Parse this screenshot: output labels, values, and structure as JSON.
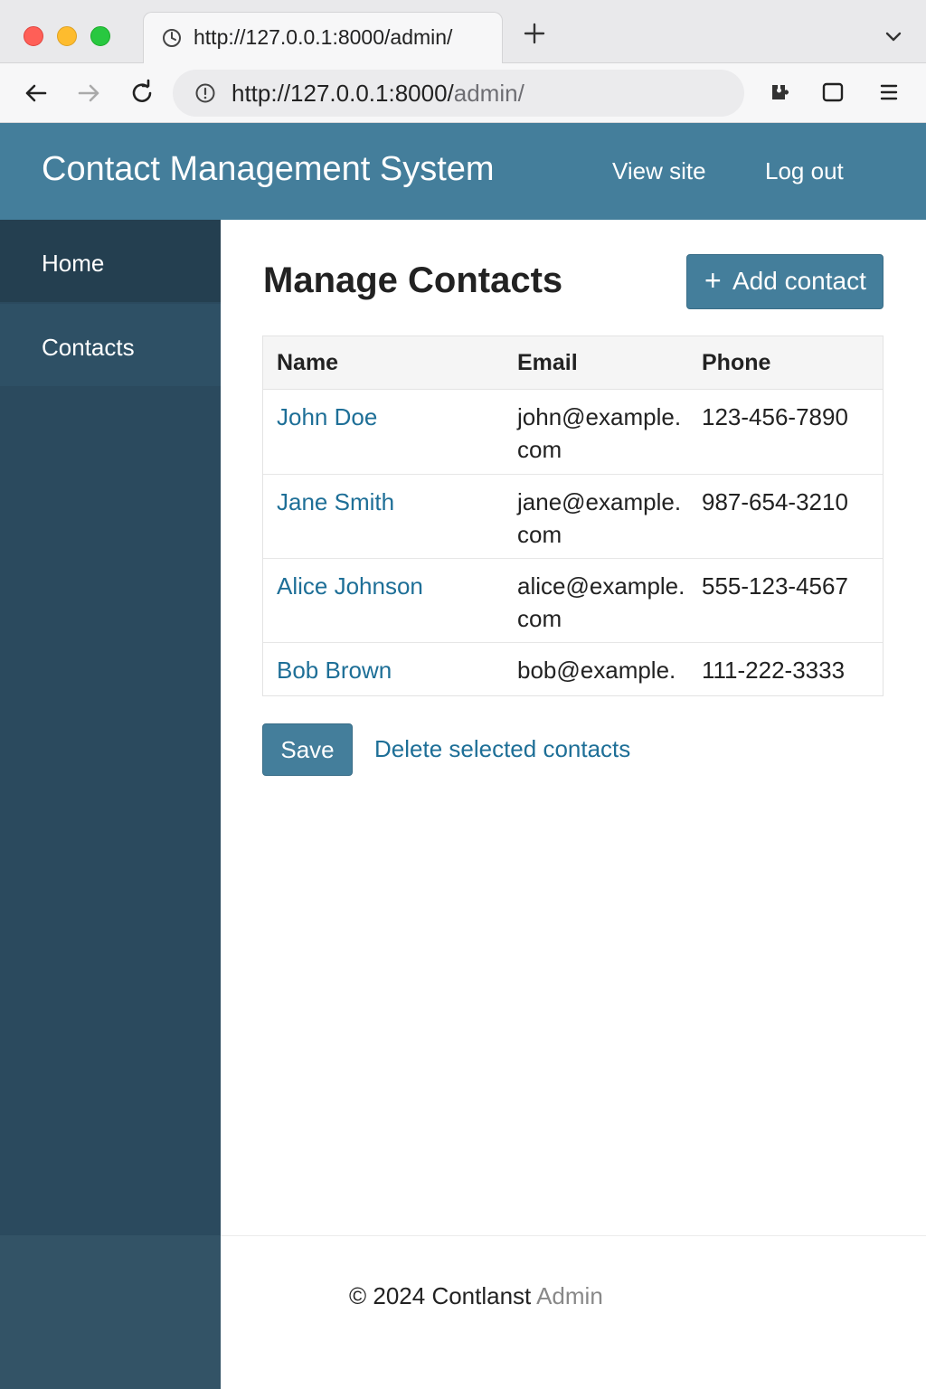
{
  "browser": {
    "tab_title": "http://127.0.0.1:8000/admin/",
    "url_main": "http://127.0.0.1:8000/",
    "url_path": "admin/"
  },
  "header": {
    "site_title": "Contact Management System",
    "view_site": "View site",
    "log_out": "Log out"
  },
  "sidebar": {
    "items": [
      {
        "label": "Home"
      },
      {
        "label": "Contacts"
      }
    ]
  },
  "main": {
    "title": "Manage Contacts",
    "add_button": "Add contact",
    "columns": [
      "Name",
      "Email",
      "Phone"
    ],
    "rows": [
      {
        "name": "John Doe",
        "email": "john@example.com",
        "phone": "123-456-7890"
      },
      {
        "name": "Jane Smith",
        "email": "jane@example.com",
        "phone": "987-654-3210"
      },
      {
        "name": "Alice Johnson",
        "email": "alice@example.com",
        "phone": "555-123-4567"
      },
      {
        "name": "Bob Brown",
        "email": "bob@example.",
        "phone": "111-222-3333"
      }
    ],
    "save_button": "Save",
    "delete_link": "Delete selected contacts"
  },
  "footer": {
    "text": "© 2024 Contlanst",
    "dim": "Admin"
  },
  "colors": {
    "header": "#447e9b",
    "sidebar": "#2b4a5e",
    "link": "#1e6f97"
  }
}
